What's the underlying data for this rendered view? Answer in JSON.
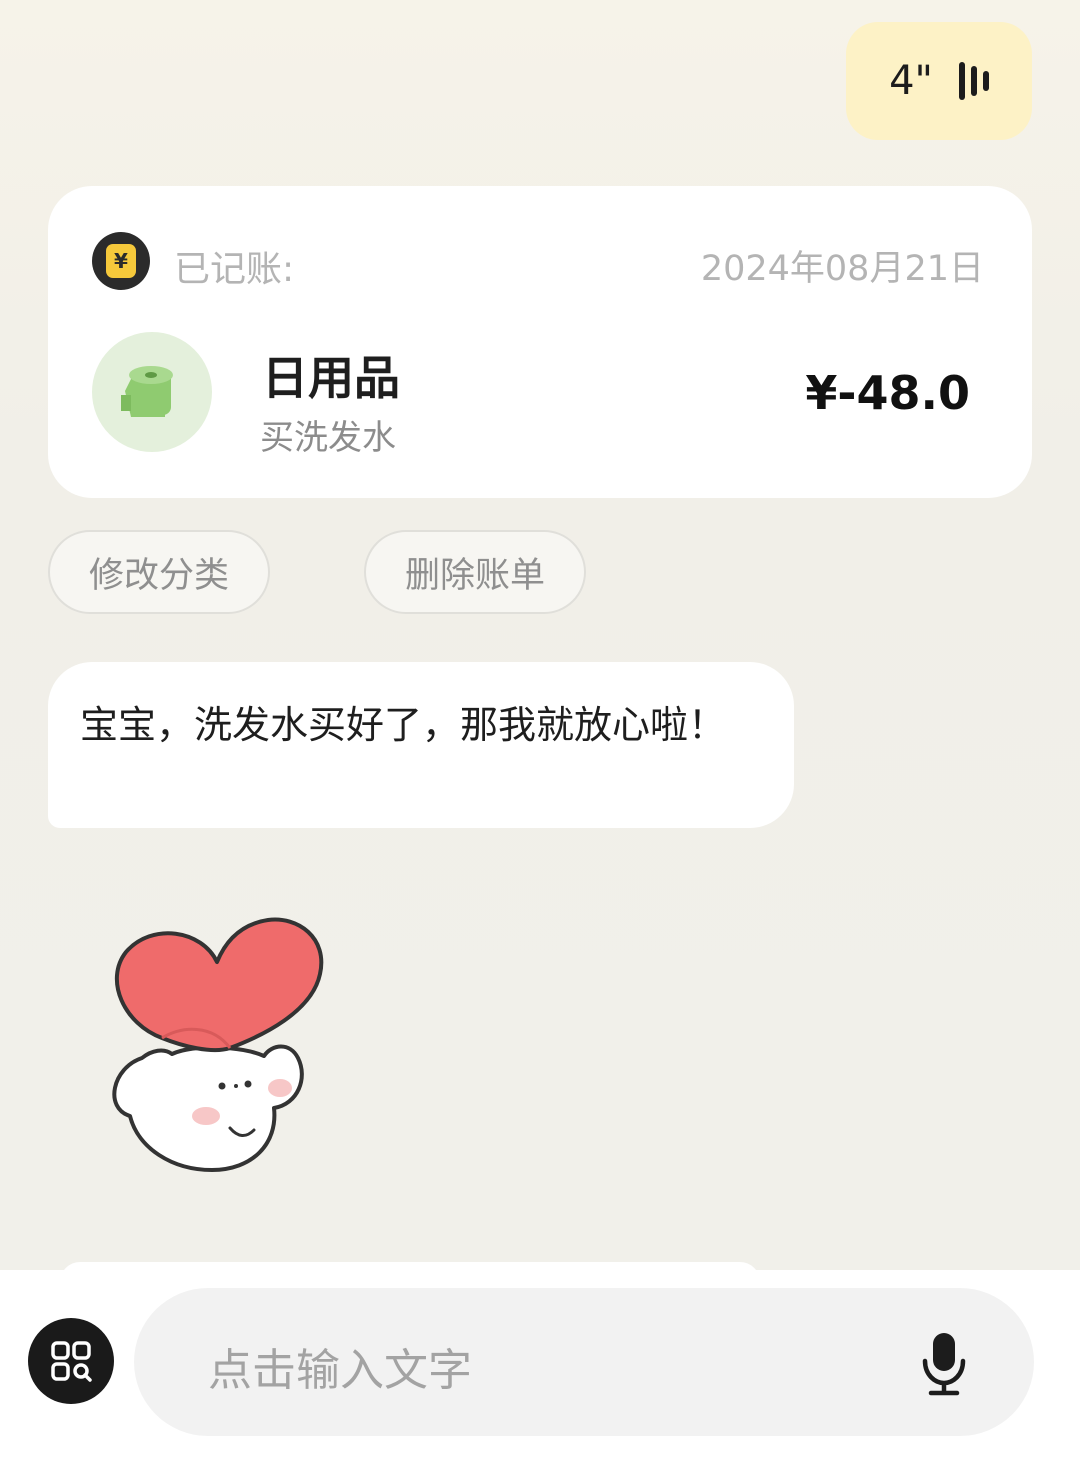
{
  "voice_message": {
    "duration": "4\"",
    "icon": "voice-wave-icon"
  },
  "record_card": {
    "logo_icon": "yen-coin-icon",
    "logo_symbol": "¥",
    "label": "已记账:",
    "date": "2024年08月21日",
    "category_icon": "toilet-paper-icon",
    "category": "日用品",
    "note": "买洗发水",
    "amount": "¥-48.0"
  },
  "actions": {
    "edit_category": "修改分类",
    "delete_bill": "删除账单"
  },
  "reply": {
    "text": "宝宝，洗发水买好了，那我就放心啦！"
  },
  "sticker": {
    "icon": "heart-bunny-sticker"
  },
  "input_bar": {
    "menu_icon": "grid-menu-icon",
    "placeholder": "点击输入文字",
    "mic_icon": "microphone-icon"
  },
  "colors": {
    "voice_bubble": "#fdf2c6",
    "card_bg": "#ffffff",
    "category_circle": "#e4f0dc",
    "category_green": "#8fcb70",
    "heart": "#ef6b6b"
  }
}
